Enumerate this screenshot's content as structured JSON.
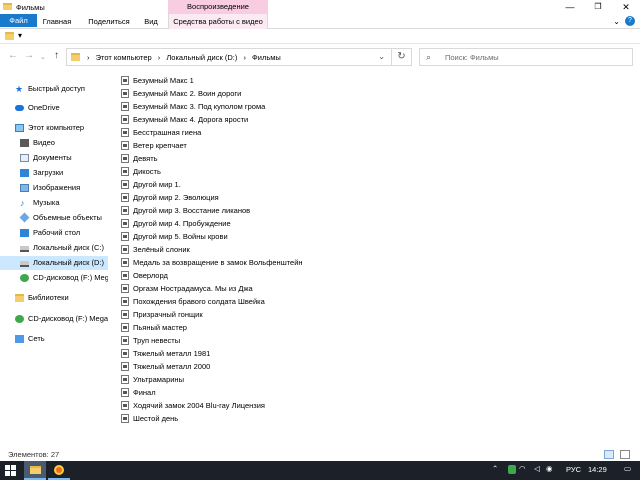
{
  "window": {
    "title": "Фильмы",
    "context_tab_header": "Воспроизведение",
    "min_label": "—",
    "max_label": "❐",
    "close_label": "✕"
  },
  "ribbon": {
    "tabs": [
      "Файл",
      "Главная",
      "Поделиться",
      "Вид",
      "Средства работы с видео"
    ],
    "expand_label": "⌄",
    "help_label": "?"
  },
  "quick_access": {
    "dropdown_label": "▾"
  },
  "nav": {
    "back": "←",
    "forward": "→",
    "history": "⌄",
    "up": "↑",
    "address": [
      "Этот компьютер",
      "Локальный диск (D:)",
      "Фильмы"
    ],
    "separator": "›",
    "address_dropdown": "⌄",
    "refresh": "↻",
    "search_placeholder": "Поиск: Фильмы",
    "search_icon": "⌕"
  },
  "sidebar": {
    "items": [
      {
        "label": "Быстрый доступ",
        "icon": "star-icon"
      },
      {
        "label": "OneDrive",
        "icon": "cloud-icon"
      },
      {
        "label": "Этот компьютер",
        "icon": "computer-icon"
      },
      {
        "label": "Видео",
        "icon": "video-icon"
      },
      {
        "label": "Документы",
        "icon": "documents-icon"
      },
      {
        "label": "Загрузки",
        "icon": "downloads-icon"
      },
      {
        "label": "Изображения",
        "icon": "pictures-icon"
      },
      {
        "label": "Музыка",
        "icon": "music-icon"
      },
      {
        "label": "Объемные объекты",
        "icon": "3d-objects-icon"
      },
      {
        "label": "Рабочий стол",
        "icon": "desktop-icon"
      },
      {
        "label": "Локальный диск (C:)",
        "icon": "disk-icon"
      },
      {
        "label": "Локальный диск (D:)",
        "icon": "disk-icon"
      },
      {
        "label": "CD-дисковод (F:) Meg",
        "icon": "cd-drive-icon"
      },
      {
        "label": "Библиотеки",
        "icon": "libraries-icon"
      },
      {
        "label": "CD-дисковод (F:) Mega",
        "icon": "cd-drive-icon"
      },
      {
        "label": "Сеть",
        "icon": "network-icon"
      }
    ],
    "selected_index": 11
  },
  "files": [
    "Безумный Макс 1",
    "Безумный Макс 2. Воин дороги",
    "Безумный Макс 3. Под куполом грома",
    "Безумный Макс 4. Дорога ярости",
    "Бесстрашная гиена",
    "Ветер крепчает",
    "Девять",
    "Дикость",
    "Другой мир 1.",
    "Другой мир 2. Эволюция",
    "Другой мир 3. Восстание ликанов",
    "Другой мир 4. Пробуждение",
    "Другой мир 5. Войны крови",
    "Зелёный слоник",
    "Медаль за возвращение в замок Вольфенштейн",
    "Оверлорд",
    "Оргазм Нострадамуса. Мы из Джа",
    "Похождения бравого солдата Швейка",
    "Призрачный гонщик",
    "Пьяный мастер",
    "Труп невесты",
    "Тяжелый металл 1981",
    "Тяжелый металл 2000",
    "Ультрамарины",
    "Финал",
    "Ходячий замок 2004 Blu-ray Лицензия",
    "Шестой день"
  ],
  "status": {
    "items_count": "Элементов: 27"
  },
  "taskbar": {
    "tray_chevron": "⌃",
    "wifi": "◠",
    "sound": "◁",
    "volume": "◉",
    "language": "РУС",
    "clock": "14:29",
    "notifications": "▭"
  },
  "colors": {
    "accent": "#1979ca",
    "selection": "#cce8ff",
    "context_tab": "#f8cce1",
    "taskbar": "#1c2029"
  }
}
